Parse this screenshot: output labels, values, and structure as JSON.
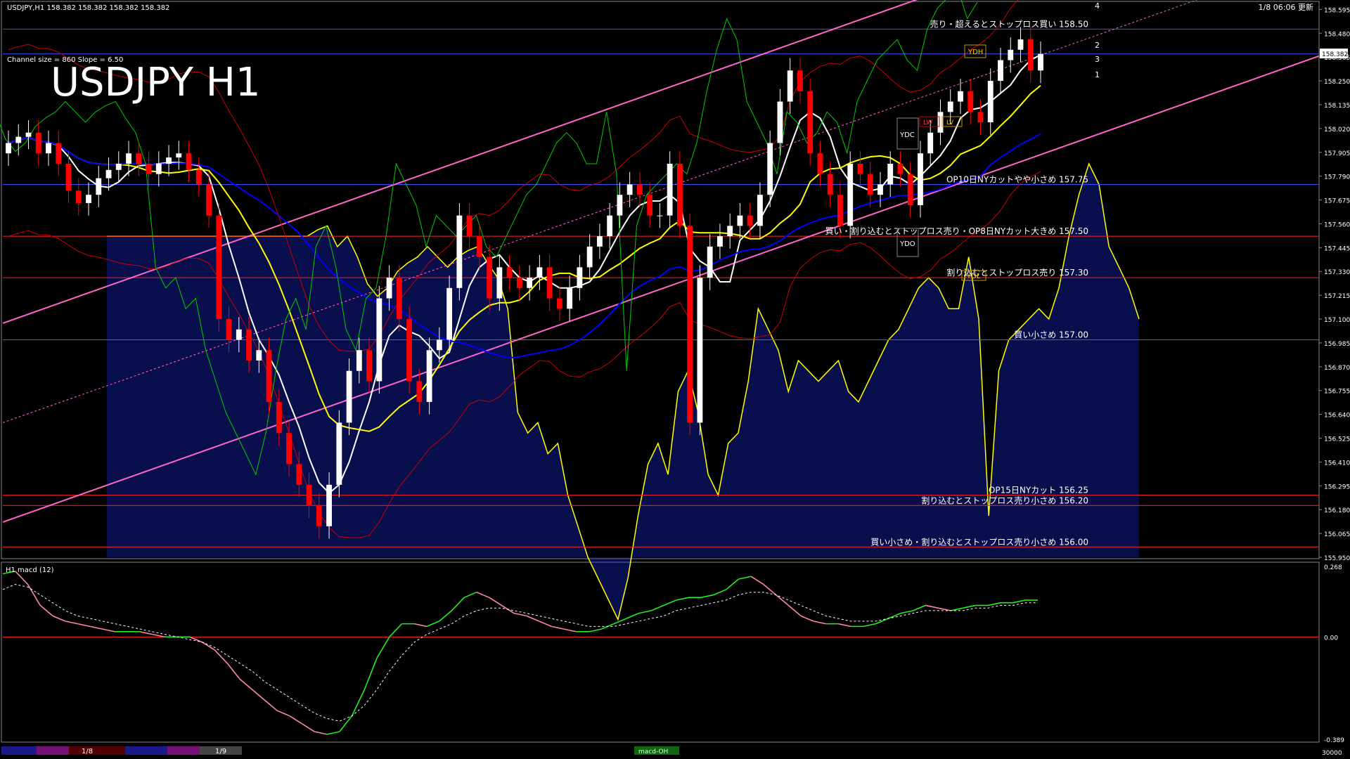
{
  "header": {
    "symbol_info": "USDJPY,H1  158.382 158.382 158.382 158.382",
    "updated": "1/8 06:06 更新",
    "big_title": "USDJPY H1",
    "channel_info": "Channel size = 860 Slope = 6.50",
    "macd_label": "H1  macd (12)"
  },
  "colors": {
    "background": "#000000",
    "bull_candle": "#ffffff",
    "bear_candle": "#ff0000",
    "ma_fast": "#ffffff",
    "ma_mid": "#ffff00",
    "ma_slow": "#0000ff",
    "channel": "#ff66cc",
    "chikou": "#00cc00",
    "bollinger": "#cc0000",
    "kumo_cloud_blue": "#1a2bd9",
    "kumo_cloud_orange": "#ff9933",
    "macd_up": "#22ee22",
    "macd_down": "#ff88aa",
    "grid_blue_line": "#3355ff",
    "level_red_line": "#ff2222"
  },
  "price_axis": {
    "ticks": [
      "158.595",
      "158.480",
      "158.365",
      "158.250",
      "158.135",
      "158.020",
      "157.905",
      "157.790",
      "157.675",
      "157.560",
      "157.445",
      "157.330",
      "157.215",
      "157.100",
      "156.985",
      "156.870",
      "156.755",
      "156.640",
      "156.525",
      "156.410",
      "156.295",
      "156.180",
      "156.065",
      "155.950"
    ],
    "current_price": "158.382",
    "min": 155.95,
    "max": 158.62
  },
  "macd_axis": {
    "ticks": [
      "0.268",
      "0.00",
      "-0.389"
    ],
    "bottom_label": "30000"
  },
  "levels": [
    {
      "price": 158.5,
      "label": "売り・超えるとストップロス買い 158.50",
      "color": "#3355ff"
    },
    {
      "price": 158.38,
      "label": "",
      "color": "#3355ff"
    },
    {
      "price": 157.75,
      "label": "OP10日NYカットやや小さめ 157.75",
      "color": "#3355ff"
    },
    {
      "price": 157.5,
      "label": "買い・割り込むとストップロス売り・OP8日NYカット大きめ 157.50",
      "color": "#ff2222"
    },
    {
      "price": 157.3,
      "label": "割り込むとストップロス売り 157.30",
      "color": "#ff2222"
    },
    {
      "price": 157.0,
      "label": "買い小さめ 157.00",
      "color": "#ff2222"
    },
    {
      "price": 156.25,
      "label": "OP15日NYカット 156.25",
      "color": "#ff2222"
    },
    {
      "price": 156.2,
      "label": "割り込むとストップロス売り小さめ 156.20",
      "color": "#ff2222"
    },
    {
      "price": 156.0,
      "label": "買い小さめ・割り込むとストップロス売り小さめ 156.00",
      "color": "#ff2222"
    }
  ],
  "box_labels": [
    "YDH",
    "YDC",
    "YDO",
    "YDL",
    "LW",
    "LV"
  ],
  "channel_numbers": [
    "4",
    "2",
    "3",
    "1"
  ],
  "bottom_bar": {
    "dates": [
      "1/8",
      "1/9"
    ],
    "tag": "macd-OH"
  },
  "chart_data": {
    "type": "candlestick",
    "title": "USDJPY H1",
    "series": [
      {
        "name": "close",
        "values": [
          157.95,
          157.98,
          158.0,
          157.9,
          157.95,
          157.85,
          157.72,
          157.66,
          157.7,
          157.78,
          157.82,
          157.85,
          157.9,
          157.85,
          157.8,
          157.85,
          157.88,
          157.9,
          157.82,
          157.75,
          157.6,
          157.1,
          157.0,
          157.05,
          156.9,
          156.95,
          156.7,
          156.55,
          156.4,
          156.3,
          156.2,
          156.1,
          156.3,
          156.6,
          156.85,
          156.95,
          156.8,
          157.2,
          157.3,
          157.1,
          156.8,
          156.7,
          156.95,
          157.0,
          157.25,
          157.6,
          157.5,
          157.4,
          157.2,
          157.35,
          157.3,
          157.25,
          157.3,
          157.35,
          157.2,
          157.15,
          157.25,
          157.35,
          157.45,
          157.5,
          157.6,
          157.7,
          157.75,
          157.7,
          157.6,
          157.6,
          157.85,
          157.55,
          156.6,
          157.3,
          157.45,
          157.5,
          157.55,
          157.6,
          157.55,
          157.7,
          157.95,
          158.15,
          158.3,
          158.2,
          157.9,
          157.8,
          157.7,
          157.55,
          157.85,
          157.8,
          157.7,
          157.75,
          157.85,
          157.8,
          157.65,
          157.9,
          158.0,
          158.1,
          158.15,
          158.2,
          158.1,
          158.05,
          158.25,
          158.35,
          158.4,
          158.45,
          158.3,
          158.38
        ]
      }
    ],
    "ylim": [
      155.95,
      158.62
    ],
    "macd": {
      "values": [
        0.24,
        0.25,
        0.2,
        0.12,
        0.08,
        0.06,
        0.05,
        0.04,
        0.03,
        0.02,
        0.02,
        0.02,
        0.01,
        0.0,
        0.0,
        0.0,
        -0.02,
        -0.05,
        -0.1,
        -0.16,
        -0.2,
        -0.24,
        -0.28,
        -0.3,
        -0.33,
        -0.36,
        -0.37,
        -0.36,
        -0.3,
        -0.2,
        -0.08,
        0.0,
        0.05,
        0.05,
        0.04,
        0.06,
        0.1,
        0.15,
        0.17,
        0.15,
        0.12,
        0.09,
        0.08,
        0.06,
        0.04,
        0.03,
        0.02,
        0.02,
        0.03,
        0.05,
        0.07,
        0.09,
        0.1,
        0.12,
        0.14,
        0.15,
        0.15,
        0.16,
        0.18,
        0.22,
        0.23,
        0.2,
        0.16,
        0.12,
        0.08,
        0.06,
        0.05,
        0.05,
        0.04,
        0.04,
        0.05,
        0.07,
        0.09,
        0.1,
        0.12,
        0.11,
        0.1,
        0.11,
        0.12,
        0.12,
        0.13,
        0.13,
        0.14,
        0.14
      ],
      "signal": [
        0.18,
        0.2,
        0.19,
        0.16,
        0.13,
        0.1,
        0.08,
        0.07,
        0.06,
        0.05,
        0.04,
        0.03,
        0.02,
        0.01,
        0.0,
        -0.01,
        -0.02,
        -0.04,
        -0.07,
        -0.1,
        -0.13,
        -0.17,
        -0.2,
        -0.23,
        -0.26,
        -0.29,
        -0.31,
        -0.32,
        -0.3,
        -0.26,
        -0.2,
        -0.13,
        -0.07,
        -0.02,
        0.01,
        0.03,
        0.05,
        0.08,
        0.1,
        0.11,
        0.11,
        0.1,
        0.09,
        0.08,
        0.07,
        0.06,
        0.05,
        0.04,
        0.04,
        0.04,
        0.05,
        0.06,
        0.07,
        0.08,
        0.1,
        0.11,
        0.12,
        0.13,
        0.14,
        0.16,
        0.17,
        0.17,
        0.16,
        0.14,
        0.12,
        0.1,
        0.08,
        0.07,
        0.06,
        0.06,
        0.06,
        0.07,
        0.08,
        0.09,
        0.1,
        0.1,
        0.1,
        0.1,
        0.11,
        0.11,
        0.12,
        0.12,
        0.13,
        0.13
      ],
      "ylim": [
        -0.389,
        0.268
      ]
    }
  }
}
